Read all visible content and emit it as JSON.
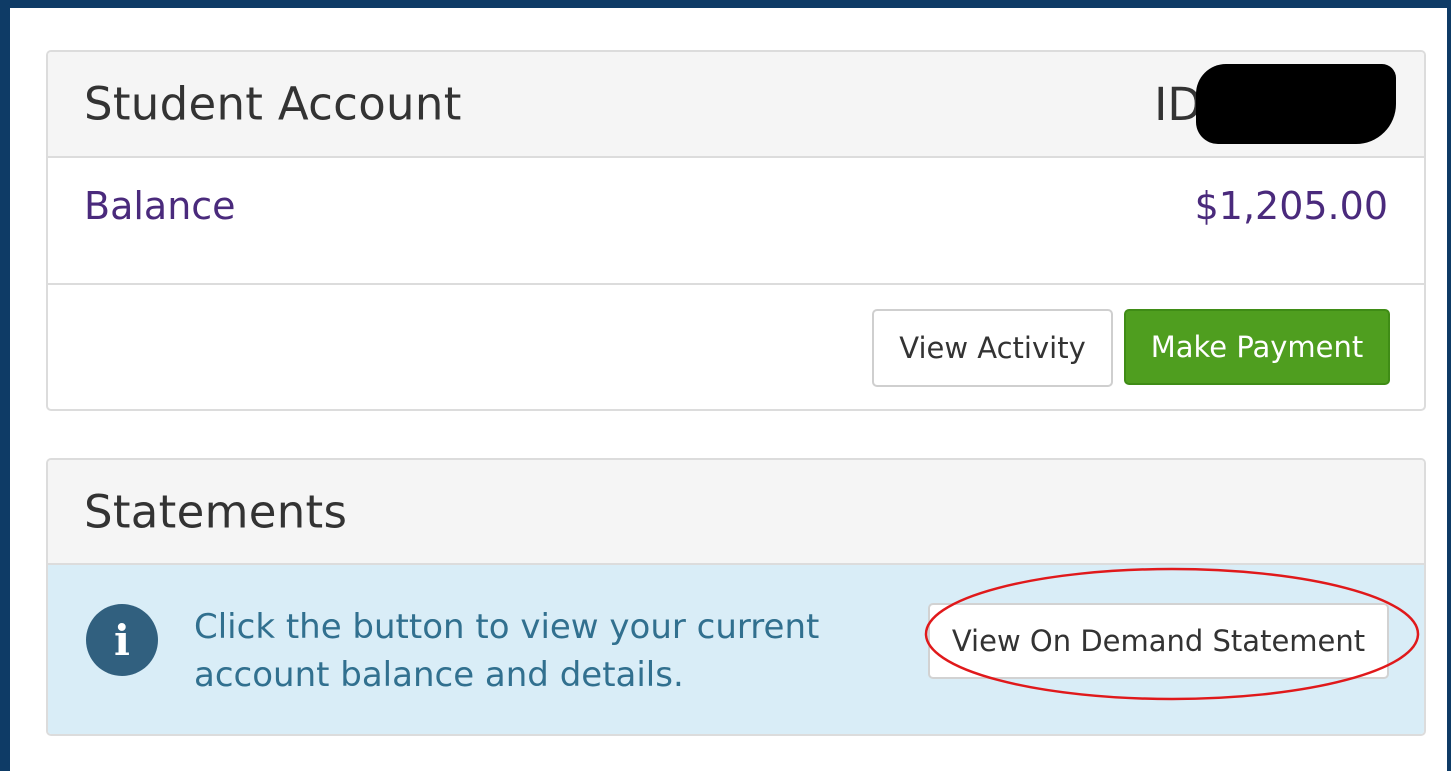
{
  "account": {
    "title": "Student Account",
    "id_label": "ID",
    "balance_label": "Balance",
    "balance_amount": "$1,205.00",
    "view_activity_label": "View Activity",
    "make_payment_label": "Make Payment"
  },
  "statements": {
    "title": "Statements",
    "info_text": "Click the button to view your current account balance and details.",
    "view_statement_label": "View On Demand Statement"
  },
  "colors": {
    "frame": "#0e3b66",
    "balance_text": "#4a2a7c",
    "payment_button": "#4f9e1f",
    "info_background": "#d9edf7",
    "info_text": "#31708f",
    "annotation": "#e0191b"
  },
  "icons": {
    "info": "info-icon"
  }
}
